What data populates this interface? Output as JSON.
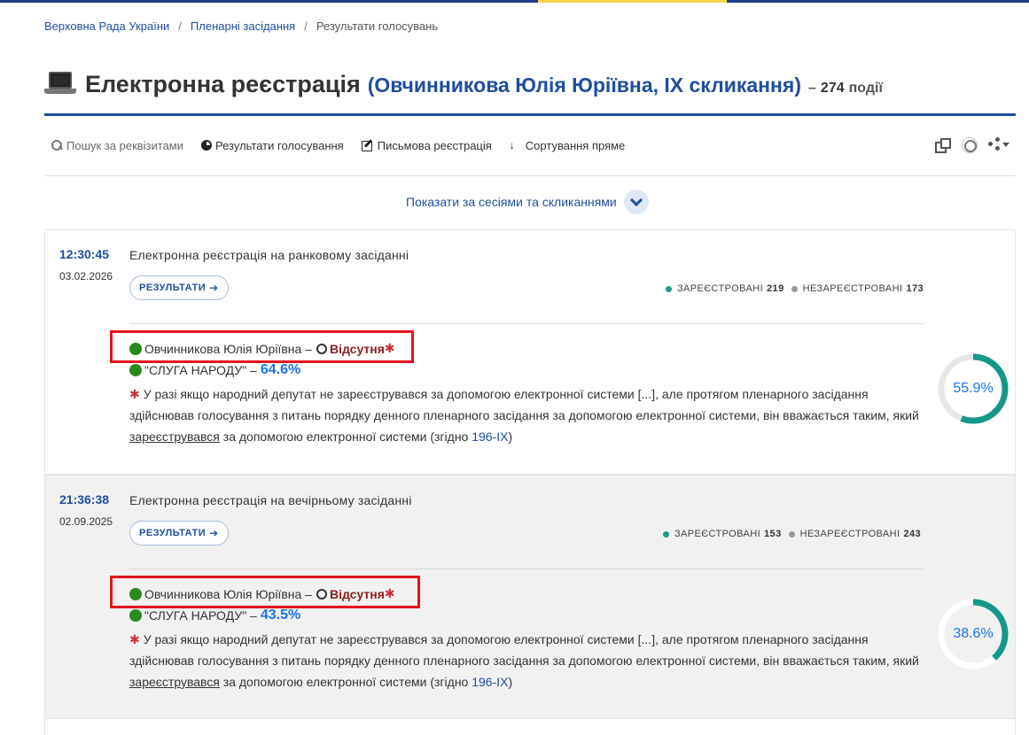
{
  "breadcrumb": {
    "items": [
      "Верховна Рада України",
      "Пленарні засідання",
      "Результати голосувань"
    ],
    "separator": "/"
  },
  "header": {
    "title": "Електронна реєстрація",
    "deputy": "(Овчинникова Юлія Юріївна, IX скликання)",
    "dash": "–",
    "count": "274",
    "count_label": "події"
  },
  "toolbar": {
    "search": "Пошук за реквізитами",
    "results": "Результати голосування",
    "written": "Письмова реєстрація",
    "sort": "Сортування пряме",
    "sort_glyph": "↓",
    "icons": [
      "window-icon",
      "brightness-icon",
      "share-icon"
    ]
  },
  "sessions_toggle": {
    "label": "Показати за сесіями та скликаннями"
  },
  "events": [
    {
      "time": "12:30:45",
      "date": "03.02.2026",
      "title": "Електронна реєстрація на ранковому засіданні",
      "results_button": "РЕЗУЛЬТАТИ",
      "registered_label": "ЗАРЕЄСТРОВАНІ",
      "registered": "219",
      "unregistered_label": "НЕЗАРЕЄСТРОВАНІ",
      "unregistered": "173",
      "deputy": "Овчинникова Юлія Юріївна",
      "dash": "–",
      "status": "Відсутня",
      "star": "✱",
      "faction": "\"СЛУГА НАРОДУ\"",
      "faction_dash": "–",
      "faction_pct": "64.6%",
      "note_a": "У разі якщо народний депутат не зареєструвався за допомогою електронної системи [...], але протягом пленарного засідання здійснював голосування з питань порядку денного пленарного засідання за допомогою електронної системи, він вважається таким, який",
      "note_u": "зареєструвався",
      "note_b": "за допомогою електронної системи (згідно",
      "note_law": "196-IX",
      "note_c": ")",
      "ring_value": 55.9,
      "ring_label": "55.9%"
    },
    {
      "time": "21:36:38",
      "date": "02.09.2025",
      "title": "Електронна реєстрація на вечірньому засіданні",
      "results_button": "РЕЗУЛЬТАТИ",
      "registered_label": "ЗАРЕЄСТРОВАНІ",
      "registered": "153",
      "unregistered_label": "НЕЗАРЕЄСТРОВАНІ",
      "unregistered": "243",
      "deputy": "Овчинникова Юлія Юріївна",
      "dash": "–",
      "status": "Відсутня",
      "star": "✱",
      "faction": "\"СЛУГА НАРОДУ\"",
      "faction_dash": "–",
      "faction_pct": "43.5%",
      "note_a": "У разі якщо народний депутат не зареєструвався за допомогою електронної системи [...], але протягом пленарного засідання здійснював голосування з питань порядку денного пленарного засідання за допомогою електронної системи, він вважається таким, який",
      "note_u": "зареєструвався",
      "note_b": "за допомогою електронної системи (згідно",
      "note_law": "196-IX",
      "note_c": ")",
      "ring_value": 38.6,
      "ring_label": "38.6%"
    }
  ],
  "colors": {
    "primary": "#1f4e9e",
    "accent_yellow": "#f7d64a",
    "ring_teal": "#13988a",
    "ring_track": "#e7e7e7",
    "highlight_red": "#e3141a",
    "absent_red": "#8b1d1d",
    "percent_blue": "#1a73e8",
    "present_green": "#2a8a1e"
  }
}
